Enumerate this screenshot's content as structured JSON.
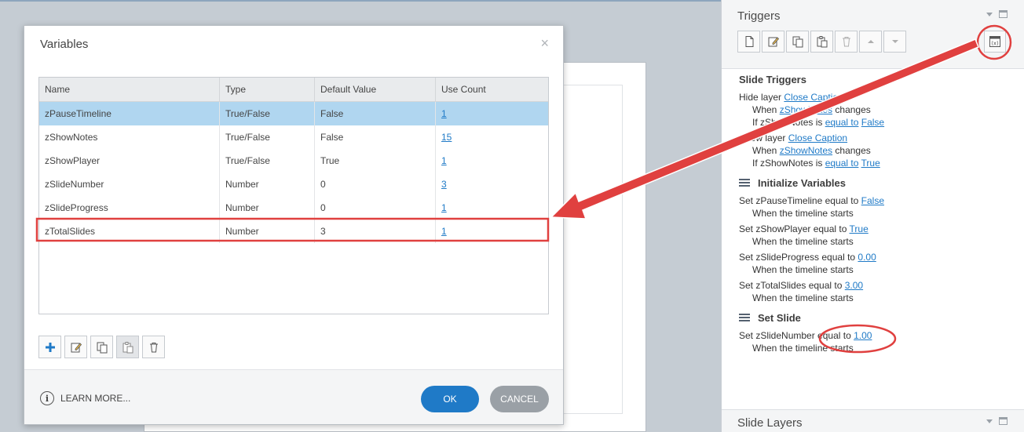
{
  "right_panel": {
    "title": "Triggers",
    "layers_title": "Slide Layers",
    "section_slide_triggers": "Slide Triggers",
    "trigger1": {
      "action": "Hide layer ",
      "layer": "Close Caption",
      "when": "When ",
      "var": "zShowNotes",
      "event": " changes",
      "if": "If zShowNotes is ",
      "cond": "equal to",
      "val": "False"
    },
    "trigger2": {
      "action": "Show layer ",
      "layer": "Close Caption",
      "when": "When ",
      "var": "zShowNotes",
      "event": " changes",
      "if": "If zShowNotes is ",
      "cond": "equal to",
      "val": "True"
    },
    "group_init": "Initialize Variables",
    "init_items": [
      {
        "set": "Set zPauseTimeline equal to ",
        "val": "False",
        "when": "When the timeline starts"
      },
      {
        "set": "Set zShowPlayer equal to ",
        "val": "True",
        "when": "When the timeline starts"
      },
      {
        "set": "Set zSlideProgress equal to ",
        "val": "0.00",
        "when": "When the timeline starts"
      },
      {
        "set": "Set zTotalSlides equal to ",
        "val": "3.00",
        "when": "When the timeline starts"
      }
    ],
    "group_set_slide": "Set Slide",
    "set_slide_item": {
      "set": "Set zSlideNumber equal to ",
      "val": "1.00",
      "when": "When the timeline starts"
    }
  },
  "dialog": {
    "title": "Variables",
    "close": "×",
    "columns": [
      "Name",
      "Type",
      "Default Value",
      "Use Count"
    ],
    "rows": [
      {
        "name": "zPauseTimeline",
        "type": "True/False",
        "default": "False",
        "count": "1"
      },
      {
        "name": "zShowNotes",
        "type": "True/False",
        "default": "False",
        "count": "15"
      },
      {
        "name": "zShowPlayer",
        "type": "True/False",
        "default": "True",
        "count": "1"
      },
      {
        "name": "zSlideNumber",
        "type": "Number",
        "default": "0",
        "count": "3"
      },
      {
        "name": "zSlideProgress",
        "type": "Number",
        "default": "0",
        "count": "1"
      },
      {
        "name": "zTotalSlides",
        "type": "Number",
        "default": "3",
        "count": "1"
      }
    ],
    "learn_more": "LEARN MORE...",
    "ok": "OK",
    "cancel": "CANCEL"
  },
  "colors": {
    "accent": "#1f7ac7",
    "selected_row": "#b0d6f0",
    "annotation_red": "#e0403f"
  }
}
